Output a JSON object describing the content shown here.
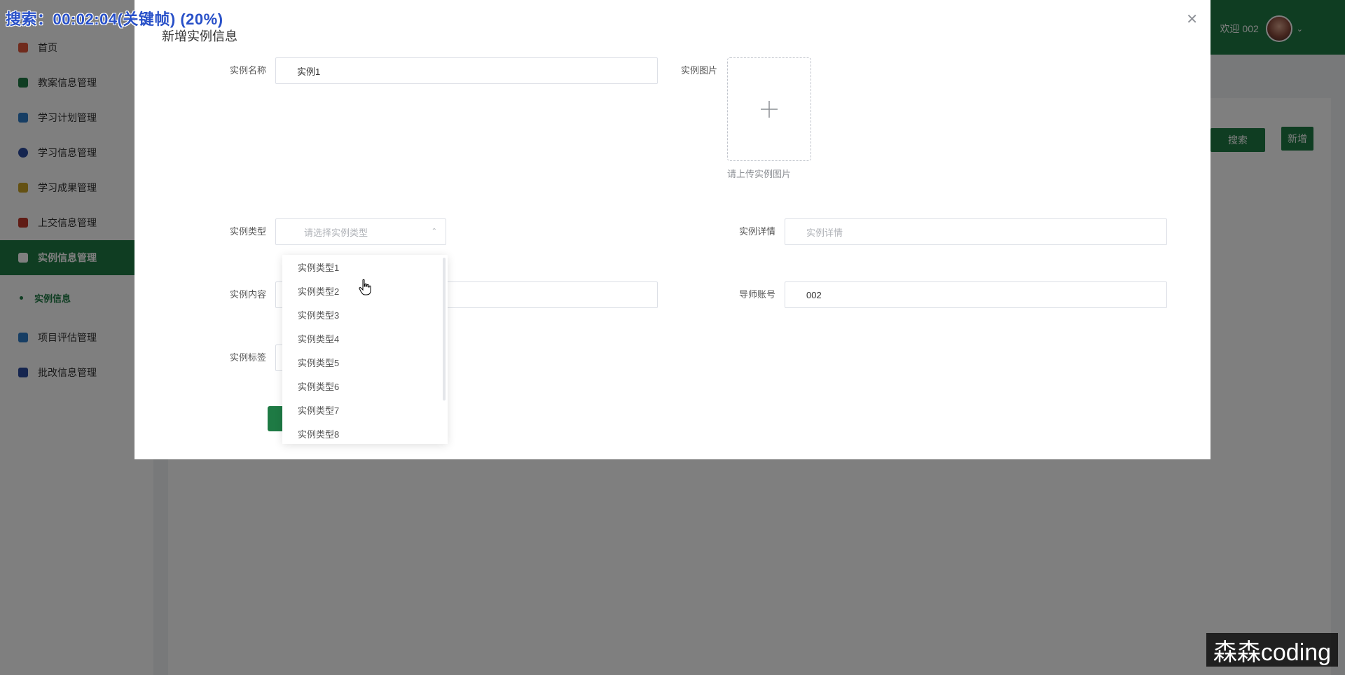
{
  "osd_text": "搜索：00:02:04(关键帧) (20%)",
  "sidebar": {
    "items": [
      {
        "label": "首页",
        "icon": "home-icon",
        "color": "#e0563b"
      },
      {
        "label": "教案信息管理",
        "icon": "envelope-icon",
        "color": "#1e7a44"
      },
      {
        "label": "学习计划管理",
        "icon": "book-icon",
        "color": "#2f7dc8"
      },
      {
        "label": "学习信息管理",
        "icon": "capsule-icon",
        "color": "#2b4a9e"
      },
      {
        "label": "学习成果管理",
        "icon": "trophy-icon",
        "color": "#c9a227"
      },
      {
        "label": "上交信息管理",
        "icon": "briefcase-icon",
        "color": "#c0392b"
      },
      {
        "label": "实例信息管理",
        "icon": "cart-icon",
        "color": "#ffffff"
      },
      {
        "label": "项目评估管理",
        "icon": "grid-icon",
        "color": "#2f7dc8"
      },
      {
        "label": "批改信息管理",
        "icon": "badge-icon",
        "color": "#2b4a9e"
      }
    ],
    "sub_item": "实例信息"
  },
  "header": {
    "welcome": "欢迎 002"
  },
  "background_buttons": {
    "search": "搜索",
    "add": "新增"
  },
  "dialog": {
    "title": "新增实例信息",
    "fields": {
      "name_label": "实例名称",
      "name_value": "实例1",
      "image_label": "实例图片",
      "upload_hint": "请上传实例图片",
      "type_label": "实例类型",
      "type_placeholder": "请选择实例类型",
      "detail_label": "实例详情",
      "detail_placeholder": "实例详情",
      "content_label": "实例内容",
      "account_label": "导师账号",
      "account_value": "002",
      "tag_label": "实例标签"
    },
    "dropdown_options": [
      "实例类型1",
      "实例类型2",
      "实例类型3",
      "实例类型4",
      "实例类型5",
      "实例类型6",
      "实例类型7",
      "实例类型8"
    ]
  },
  "watermark": "森森coding"
}
